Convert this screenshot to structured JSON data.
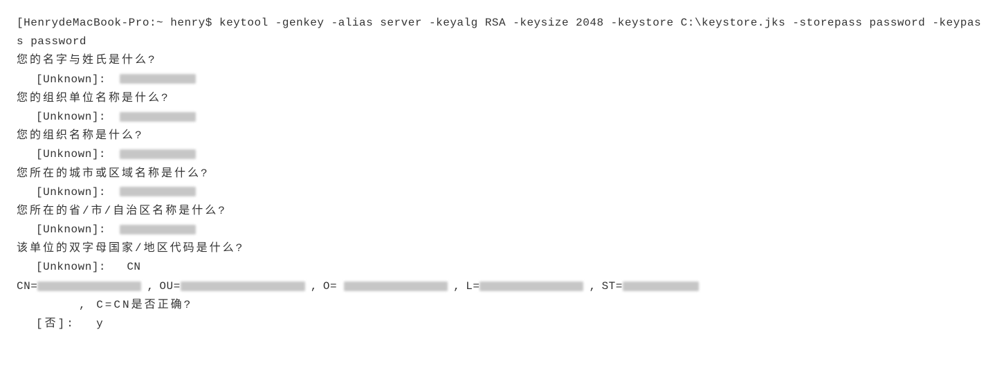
{
  "terminal": {
    "prompt_open": "[",
    "prompt_host": "HenrydeMacBook-Pro:~ henry$",
    "command": "keytool -genkey -alias server -keyalg RSA -keysize 2048 -keystore C:\\keystore.jks -storepass password -keypass password",
    "prompts": [
      {
        "question": "您的名字与姓氏是什么?",
        "label": "[Unknown]:",
        "answer": "",
        "redacted": true
      },
      {
        "question": "您的组织单位名称是什么?",
        "label": "[Unknown]:",
        "answer": "",
        "redacted": true
      },
      {
        "question": "您的组织名称是什么?",
        "label": "[Unknown]:",
        "answer": "",
        "redacted": true
      },
      {
        "question": "您所在的城市或区域名称是什么?",
        "label": "[Unknown]:",
        "answer": "",
        "redacted": true
      },
      {
        "question": "您所在的省/市/自治区名称是什么?",
        "label": "[Unknown]:",
        "answer": "",
        "redacted": true
      },
      {
        "question": "该单位的双字母国家/地区代码是什么?",
        "label": "[Unknown]:",
        "answer": "CN",
        "redacted": false
      }
    ],
    "summary": {
      "pairs": [
        {
          "key": "CN="
        },
        {
          "key": "OU="
        },
        {
          "key": "O="
        },
        {
          "key": "L="
        },
        {
          "key": "ST="
        }
      ],
      "tail": ", C=CN是否正确?"
    },
    "confirm": {
      "label": "[否]:",
      "answer": "y"
    }
  }
}
